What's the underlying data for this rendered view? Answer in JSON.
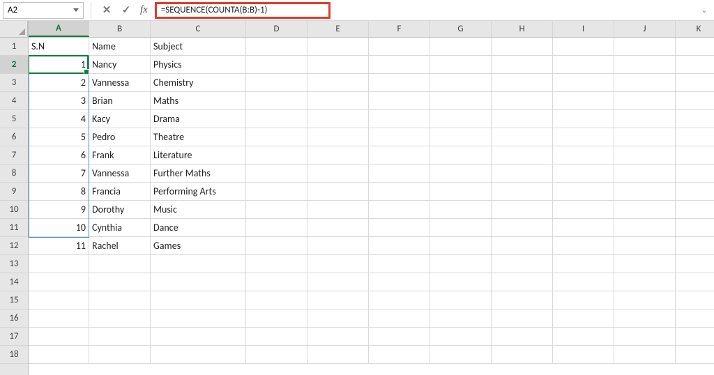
{
  "nameBox": {
    "value": "A2"
  },
  "fxLabel": "fx",
  "formulaInput": {
    "value": "=SEQUENCE(COUNTA(B:B)-1)"
  },
  "columns": [
    "A",
    "B",
    "C",
    "D",
    "E",
    "F",
    "G",
    "H",
    "I",
    "J",
    "K"
  ],
  "rowNumbers": [
    "1",
    "2",
    "3",
    "4",
    "5",
    "6",
    "7",
    "8",
    "9",
    "10",
    "11",
    "12",
    "13",
    "14",
    "15",
    "16",
    "17",
    "18"
  ],
  "activeRowIndex": 1,
  "activeColIndex": 0,
  "data": {
    "headers": {
      "a": "S.N",
      "b": "Name",
      "c": "Subject"
    },
    "rows": [
      {
        "sn": "1",
        "name": "Nancy",
        "subject": "Physics"
      },
      {
        "sn": "2",
        "name": "Vannessa",
        "subject": "Chemistry"
      },
      {
        "sn": "3",
        "name": "Brian",
        "subject": "Maths"
      },
      {
        "sn": "4",
        "name": "Kacy",
        "subject": "Drama"
      },
      {
        "sn": "5",
        "name": "Pedro",
        "subject": "Theatre"
      },
      {
        "sn": "6",
        "name": "Frank",
        "subject": "Literature"
      },
      {
        "sn": "7",
        "name": "Vannessa",
        "subject": "Further Maths"
      },
      {
        "sn": "8",
        "name": "Francia",
        "subject": "Performing Arts"
      },
      {
        "sn": "9",
        "name": "Dorothy",
        "subject": "Music"
      },
      {
        "sn": "10",
        "name": "Cynthia",
        "subject": "Dance"
      },
      {
        "sn": "11",
        "name": "Rachel",
        "subject": "Games"
      }
    ]
  }
}
